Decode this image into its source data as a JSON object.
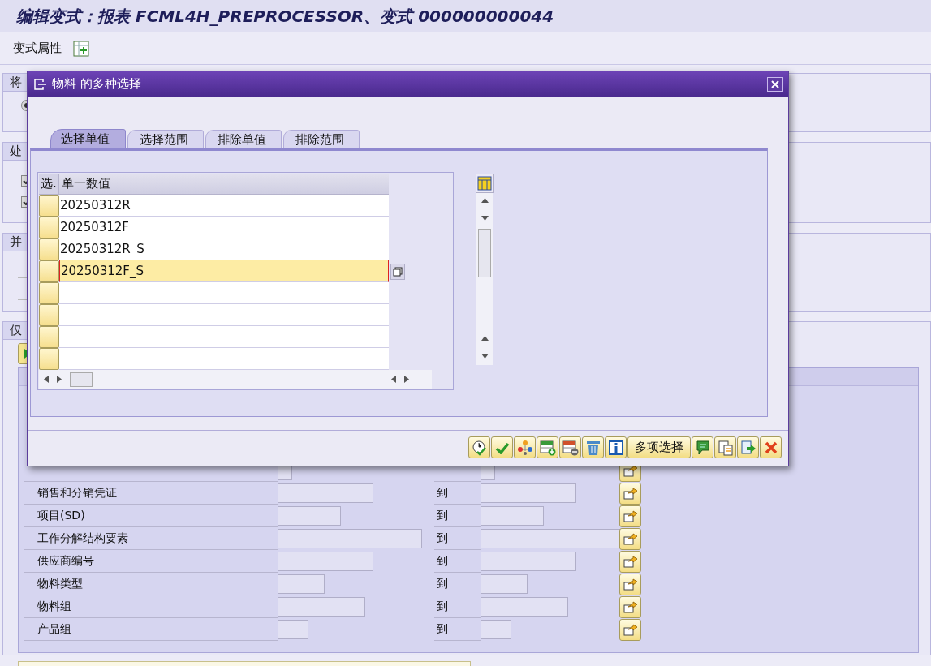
{
  "window": {
    "title": "编辑变式：报表 FCML4H_PREPROCESSOR、变式 000000000044"
  },
  "toolbar": {
    "label": "变式属性"
  },
  "background_sections": [
    {
      "title": "将",
      "radio": {
        "selected": true
      }
    },
    {
      "title": "处",
      "checkboxes": [
        {
          "checked": true
        },
        {
          "checked": true
        }
      ]
    },
    {
      "title": "并"
    },
    {
      "title": "仅"
    }
  ],
  "selection_rows": [
    {
      "label": "销售和分销凭证",
      "to": "到"
    },
    {
      "label": "项目(SD)",
      "to": "到"
    },
    {
      "label": "工作分解结构要素",
      "to": "到"
    },
    {
      "label": "供应商编号",
      "to": "到"
    },
    {
      "label": "物料类型",
      "to": "到"
    },
    {
      "label": "物料组",
      "to": "到"
    },
    {
      "label": "产品组",
      "to": "到"
    }
  ],
  "dialog": {
    "title": "物料 的多种选择",
    "tabs": [
      {
        "label": "选择单值",
        "selected": true
      },
      {
        "label": "选择范围",
        "selected": false
      },
      {
        "label": "排除单值",
        "selected": false
      },
      {
        "label": "排除范围",
        "selected": false
      }
    ],
    "table": {
      "columns": [
        "选.",
        "单一数值"
      ],
      "rows": [
        {
          "value": "20250312R",
          "selected": false
        },
        {
          "value": "20250312F",
          "selected": false
        },
        {
          "value": "20250312R_S",
          "selected": false
        },
        {
          "value": "20250312F_S",
          "selected": true
        }
      ]
    },
    "multi_select_button": "多项选择"
  }
}
